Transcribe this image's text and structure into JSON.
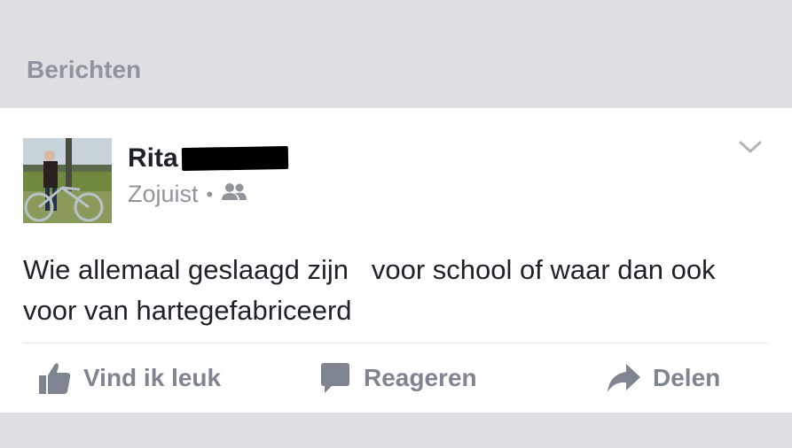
{
  "section": {
    "title": "Berichten"
  },
  "post": {
    "author_first_name": "Rita",
    "timestamp": "Zojuist",
    "separator": "•",
    "audience_icon": "friends-icon",
    "text": "Wie allemaal geslaagd zijn   voor school of waar dan ook voor van hartegefabriceerd"
  },
  "actions": {
    "like_label": "Vind ik leuk",
    "comment_label": "Reageren",
    "share_label": "Delen"
  },
  "colors": {
    "background": "#dddfe2",
    "card": "#ffffff",
    "text": "#1d2129",
    "muted": "#90949c",
    "action": "#7f8590"
  }
}
